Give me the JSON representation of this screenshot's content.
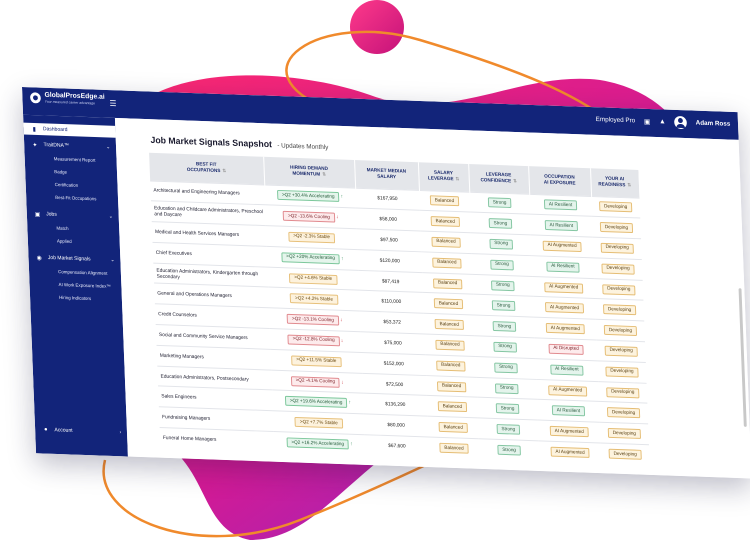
{
  "colors": {
    "navy": "#12247a",
    "accent_pink": "#e0227f",
    "accent_purple": "#8a2fd0",
    "curve_orange": "#f08a2c"
  },
  "app": {
    "logo_title": "GlobalProsEdge.ai",
    "logo_tagline": "Your measured career advantage",
    "plan": "Employed Pro",
    "user_name": "Adam Ross"
  },
  "sidebar": {
    "items": [
      {
        "label": "Dashboard",
        "icon": "chart-icon"
      },
      {
        "label": "TraitDNA™",
        "icon": "dna-icon"
      },
      {
        "label": "Jobs",
        "icon": "briefcase-icon"
      },
      {
        "label": "Job Market Signals",
        "icon": "rss-icon"
      },
      {
        "label": "Account",
        "icon": "user-icon"
      }
    ],
    "traitdna_sub": [
      "Measurement Report",
      "Badge",
      "Certification",
      "Best-Fit Occupations"
    ],
    "jobs_sub": [
      "Match",
      "Applied"
    ],
    "signals_sub": [
      "Compensation Alignment",
      "AI Work Exposure Index™",
      "Hiring Indicators"
    ]
  },
  "page": {
    "title": "Job Market Signals Snapshot",
    "subtitle": "- Updates Monthly"
  },
  "table": {
    "headers": [
      "BEST FIT\nOCCUPATIONS",
      "HIRING DEMAND\nMOMENTUM",
      "MARKET MEDIAN\nSALARY",
      "SALARY\nLEVERAGE",
      "LEVERAGE\nCONFIDENCE",
      "OCCUPATION\nAI EXPOSURE",
      "YOUR AI\nREADINESS"
    ],
    "rows": [
      {
        "occupation": "Architectural and Engineering Managers",
        "momentum": ">Q2 +30.4%  Accelerating",
        "trend": "up",
        "salary": "$167,950",
        "leverage": "Balanced",
        "confidence": "Strong",
        "exposure": "AI Resilient",
        "readiness": "Developing"
      },
      {
        "occupation": "Education and Childcare Administrators, Preschool and Daycare",
        "momentum": ">Q2 -13.6%  Cooling",
        "trend": "down",
        "salary": "$58,000",
        "leverage": "Balanced",
        "confidence": "Strong",
        "exposure": "AI Resilient",
        "readiness": "Developing"
      },
      {
        "occupation": "Medical and Health Services Managers",
        "momentum": ">Q2 -2.3%  Stable",
        "trend": "stable",
        "salary": "$97,500",
        "leverage": "Balanced",
        "confidence": "Strong",
        "exposure": "AI Augmented",
        "readiness": "Developing"
      },
      {
        "occupation": "Chief Executives",
        "momentum": ">Q2 +20%  Accelerating",
        "trend": "up",
        "salary": "$120,000",
        "leverage": "Balanced",
        "confidence": "Strong",
        "exposure": "AI Resilient",
        "readiness": "Developing"
      },
      {
        "occupation": "Education Administrators, Kindergarten through Secondary",
        "momentum": ">Q2 +4.6%  Stable",
        "trend": "stable",
        "salary": "$87,419",
        "leverage": "Balanced",
        "confidence": "Strong",
        "exposure": "AI Augmented",
        "readiness": "Developing"
      },
      {
        "occupation": "General and Operations Managers",
        "momentum": ">Q2 +4.2%  Stable",
        "trend": "stable",
        "salary": "$110,000",
        "leverage": "Balanced",
        "confidence": "Strong",
        "exposure": "AI Augmented",
        "readiness": "Developing"
      },
      {
        "occupation": "Credit Counselors",
        "momentum": ">Q2 -13.1%  Cooling",
        "trend": "down",
        "salary": "$53,372",
        "leverage": "Balanced",
        "confidence": "Strong",
        "exposure": "AI Augmented",
        "readiness": "Developing"
      },
      {
        "occupation": "Social and Community Service Managers",
        "momentum": ">Q2 -12.8%  Cooling",
        "trend": "down",
        "salary": "$75,000",
        "leverage": "Balanced",
        "confidence": "Strong",
        "exposure": "AI Disrupted",
        "readiness": "Developing"
      },
      {
        "occupation": "Marketing Managers",
        "momentum": ">Q2 +11.5%  Stable",
        "trend": "stable",
        "salary": "$152,000",
        "leverage": "Balanced",
        "confidence": "Strong",
        "exposure": "AI Resilient",
        "readiness": "Developing"
      },
      {
        "occupation": "Education Administrators, Postsecondary",
        "momentum": ">Q2 -4.1%  Cooling",
        "trend": "down",
        "salary": "$72,500",
        "leverage": "Balanced",
        "confidence": "Strong",
        "exposure": "AI Augmented",
        "readiness": "Developing"
      },
      {
        "occupation": "Sales Engineers",
        "momentum": ">Q2 +19.6%  Accelerating",
        "trend": "up",
        "salary": "$136,290",
        "leverage": "Balanced",
        "confidence": "Strong",
        "exposure": "AI Resilient",
        "readiness": "Developing"
      },
      {
        "occupation": "Fundraising Managers",
        "momentum": ">Q2 +7.7%  Stable",
        "trend": "stable",
        "salary": "$80,000",
        "leverage": "Balanced",
        "confidence": "Strong",
        "exposure": "AI Augmented",
        "readiness": "Developing"
      },
      {
        "occupation": "Funeral Home Managers",
        "momentum": ">Q2 +16.2%  Accelerating",
        "trend": "up",
        "salary": "$67,600",
        "leverage": "Balanced",
        "confidence": "Strong",
        "exposure": "AI Augmented",
        "readiness": "Developing"
      }
    ]
  }
}
